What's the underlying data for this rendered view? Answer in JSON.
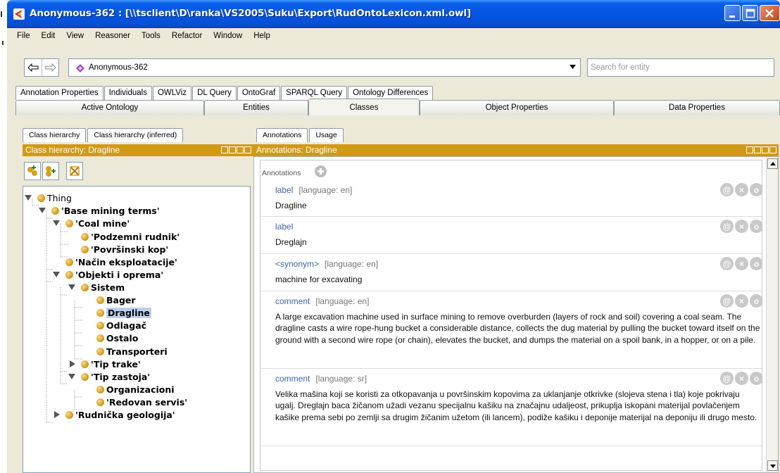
{
  "window": {
    "title": "Anonymous-362 : [\\\\tsclient\\D\\ranka\\VS2005\\Suku\\Export\\RudOntoLexicon.xml.owl]"
  },
  "menu": [
    "File",
    "Edit",
    "View",
    "Reasoner",
    "Tools",
    "Refactor",
    "Window",
    "Help"
  ],
  "nav": {
    "entity": "Anonymous-362",
    "search_placeholder": "Search for entity"
  },
  "tabs_top": [
    "Annotation Properties",
    "Individuals",
    "OWLViz",
    "DL Query",
    "OntoGraf",
    "SPARQL Query",
    "Ontology Differences"
  ],
  "tabs_main": [
    {
      "label": "Active Ontology",
      "active": false
    },
    {
      "label": "Entities",
      "active": false
    },
    {
      "label": "Classes",
      "active": true
    },
    {
      "label": "Object Properties",
      "active": false
    },
    {
      "label": "Data Properties",
      "active": false
    }
  ],
  "left": {
    "subtabs": [
      "Class hierarchy",
      "Class hierarchy (inferred)"
    ],
    "header": "Class hierarchy: Dragline",
    "tree": [
      {
        "label": "Thing",
        "level": 0,
        "toggle": "open",
        "bold": false,
        "selected": false
      },
      {
        "label": "'Base mining terms'",
        "level": 1,
        "toggle": "open",
        "bold": true,
        "selected": false
      },
      {
        "label": "'Coal mine'",
        "level": 2,
        "toggle": "open",
        "bold": true,
        "selected": false
      },
      {
        "label": "'Podzemni rudnik'",
        "level": 3,
        "toggle": "",
        "bold": true,
        "selected": false
      },
      {
        "label": "'Površinski kop'",
        "level": 3,
        "toggle": "",
        "bold": true,
        "selected": false
      },
      {
        "label": "'Način eksploatacije'",
        "level": 2,
        "toggle": "",
        "bold": true,
        "selected": false
      },
      {
        "label": "'Objekti i oprema'",
        "level": 2,
        "toggle": "open",
        "bold": true,
        "selected": false
      },
      {
        "label": "Sistem",
        "level": 3,
        "toggle": "open",
        "bold": true,
        "selected": false
      },
      {
        "label": "Bager",
        "level": 4,
        "toggle": "",
        "bold": true,
        "selected": false
      },
      {
        "label": "Dragline",
        "level": 4,
        "toggle": "",
        "bold": true,
        "selected": true
      },
      {
        "label": "Odlagač",
        "level": 4,
        "toggle": "",
        "bold": true,
        "selected": false
      },
      {
        "label": "Ostalo",
        "level": 4,
        "toggle": "",
        "bold": true,
        "selected": false
      },
      {
        "label": "Transporteri",
        "level": 4,
        "toggle": "",
        "bold": true,
        "selected": false
      },
      {
        "label": "'Tip trake'",
        "level": 3,
        "toggle": "closed",
        "bold": true,
        "selected": false
      },
      {
        "label": "'Tip zastoja'",
        "level": 3,
        "toggle": "open",
        "bold": true,
        "selected": false
      },
      {
        "label": "Organizacioni",
        "level": 4,
        "toggle": "",
        "bold": true,
        "selected": false
      },
      {
        "label": "'Redovan servis'",
        "level": 4,
        "toggle": "",
        "bold": true,
        "selected": false
      },
      {
        "label": "'Rudnička geologija'",
        "level": 2,
        "toggle": "closed",
        "bold": true,
        "selected": false
      }
    ]
  },
  "right": {
    "subtabs": [
      "Annotations",
      "Usage"
    ],
    "header": "Annotations: Dragline",
    "annotations_title": "Annotations",
    "cards": [
      {
        "property": "label",
        "lang": "[language: en]",
        "value": "Dragline"
      },
      {
        "property": "label",
        "lang": "",
        "value": "Dreglajn"
      },
      {
        "property": "<synonym>",
        "lang": "[language: en]",
        "value": "machine for excavating"
      },
      {
        "property": "comment",
        "lang": "[language: en]",
        "value": "A large excavation machine used in surface mining to remove overburden (layers of rock and soil) covering a coal seam. The dragline casts a wire rope-hung bucket a considerable distance, collects the dug material by pulling the bucket toward itself on the ground with a second wire rope (or chain), elevates the bucket, and dumps the material on a spoil bank, in a hopper, or on a pile."
      },
      {
        "property": "comment",
        "lang": "[language: sr]",
        "value": "Velika mašina koji se koristi za otkopavanja  u površinskim kopovima za uklanjanje otkrivke (slojeva stena i tla) koje pokrivaju ugalj. Dreglajn baca žičanom užadi vezanu specijalnu kašiku na značajnu udaljeost, prikuplja iskopani materijal  povlačenjem kašike prema sebi po zemlji sa drugim žičanim užetom (ili lancem), podiže kašiku i deponije materijal na deponiju ili drugo mesto."
      }
    ],
    "card_actions": [
      "@",
      "×",
      "o"
    ]
  }
}
